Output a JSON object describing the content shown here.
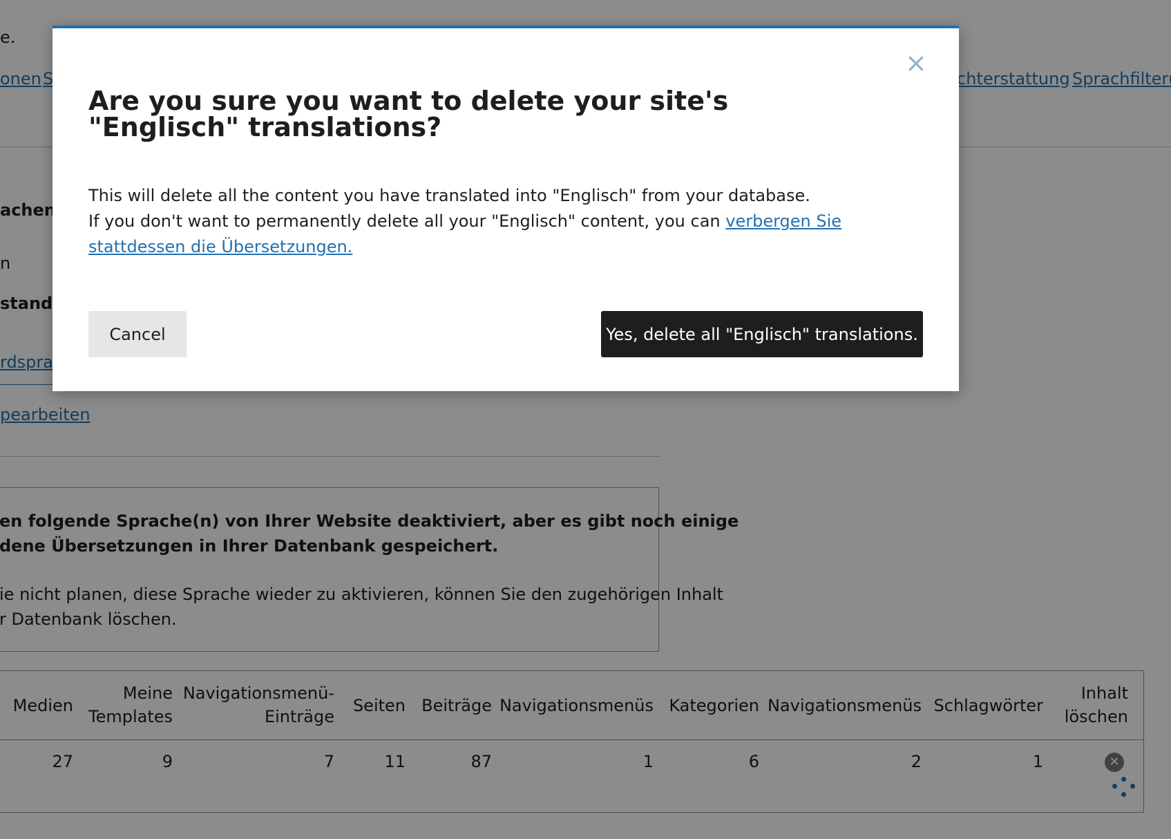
{
  "background": {
    "top_text": "e.",
    "nav_links": [
      "onen",
      "S",
      "chterstattung",
      "Sprachfilterun"
    ],
    "section_label": "achen s",
    "line_n": "n",
    "standard_label": "standar",
    "default_lang_link": "rdsprac",
    "edit_link": "pearbeiten",
    "notice": {
      "line1": "en folgende Sprache(n) von Ihrer Website deaktiviert, aber es gibt noch einige",
      "line2": "dene Übersetzungen in Ihrer Datenbank gespeichert.",
      "line3": "ie nicht planen, diese Sprache wieder zu aktivieren, können Sie den zugehörigen Inhalt",
      "line4": "r Datenbank löschen."
    },
    "table": {
      "headers": {
        "medien": "Medien",
        "templates_1": "Meine",
        "templates_2": "Templates",
        "navitems_1": "Navigationsmenü-",
        "navitems_2": "Einträge",
        "seiten": "Seiten",
        "beitraege": "Beiträge",
        "navmenus_a": "Navigationsmenüs",
        "kategorien": "Kategorien",
        "navmenus_b": "Navigationsmenüs",
        "schlagwoerter": "Schlagwörter",
        "delete_1": "Inhalt",
        "delete_2": "löschen"
      },
      "row": {
        "medien": "27",
        "templates": "9",
        "navitems": "7",
        "seiten": "11",
        "beitraege": "87",
        "navmenus_a": "1",
        "kategorien": "6",
        "navmenus_b": "2",
        "schlagwoerter": "1"
      }
    }
  },
  "modal": {
    "title": "Are you sure you want to delete your site's \"Englisch\" translations?",
    "body_line1": "This will delete all the content you have translated into \"Englisch\" from your database.",
    "body_line2_prefix": "If you don't want to permanently delete all your \"Englisch\" content, you can ",
    "body_link": "verbergen Sie stattdessen die Übersetzungen.",
    "cancel_label": "Cancel",
    "confirm_label": "Yes, delete all \"Englisch\" translations.",
    "close_icon": "×"
  }
}
